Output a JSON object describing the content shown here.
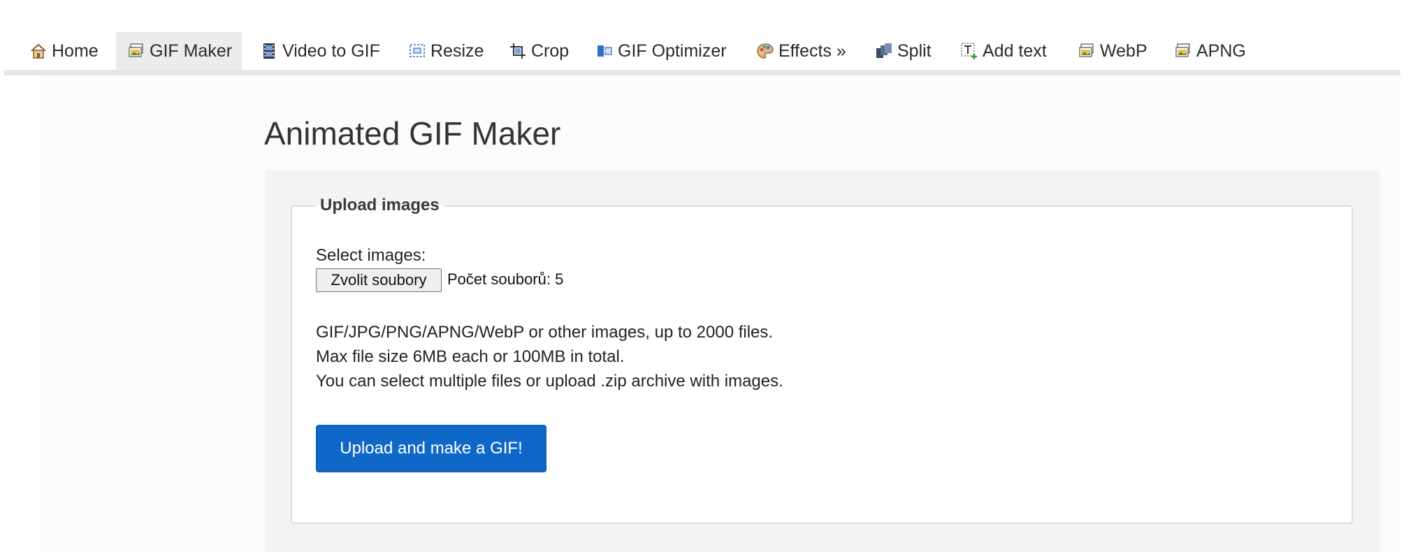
{
  "nav": {
    "items": [
      {
        "label": "Home",
        "icon": "home-icon"
      },
      {
        "label": "GIF Maker",
        "icon": "gif-maker-icon"
      },
      {
        "label": "Video to GIF",
        "icon": "film-icon"
      },
      {
        "label": "Resize",
        "icon": "resize-icon"
      },
      {
        "label": "Crop",
        "icon": "crop-icon"
      },
      {
        "label": "GIF Optimizer",
        "icon": "optimizer-icon"
      },
      {
        "label": "Effects »",
        "icon": "palette-icon"
      },
      {
        "label": "Split",
        "icon": "split-icon"
      },
      {
        "label": "Add text",
        "icon": "add-text-icon"
      },
      {
        "label": "WebP",
        "icon": "webp-icon"
      },
      {
        "label": "APNG",
        "icon": "apng-icon"
      }
    ],
    "active": "GIF Maker"
  },
  "page": {
    "title": "Animated GIF Maker"
  },
  "upload": {
    "legend": "Upload images",
    "select_label": "Select images:",
    "file_button_label": "Zvolit soubory",
    "file_count": "Počet souborů: 5",
    "info": [
      "GIF/JPG/PNG/APNG/WebP or other images, up to 2000 files.",
      "Max file size 6MB each or 100MB in total.",
      "You can select multiple files or upload .zip archive with images."
    ],
    "submit_label": "Upload and make a GIF!"
  },
  "colors": {
    "accent": "#0f67c8",
    "nav_active_bg": "#ececec"
  }
}
